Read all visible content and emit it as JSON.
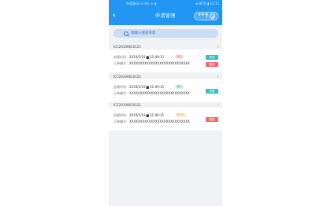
{
  "status_bar": {
    "left": "中国移动 ⊙ 4G ᯤ ▮",
    "right": "⊕ 85% ▮ 13:11"
  },
  "nav": {
    "back_icon": "‹",
    "title": "申请管理",
    "more_icon": "•••"
  },
  "search": {
    "placeholder": "请输入搜索内容"
  },
  "labels": {
    "time": "创建时间：",
    "order": "订单编号："
  },
  "cards": [
    {
      "order_no": "ICC20190610121",
      "time": "2019/5/19 ▆ 21:09:15",
      "order": "XXXXXXXXXXXXXXXXXXXXXXXXXXXX",
      "status": "驳回",
      "status_color": "#f56c6c",
      "buttons": [
        {
          "label": "修改",
          "color": "#31c2c2"
        },
        {
          "label": "删除",
          "color": "#f36a6a"
        }
      ]
    },
    {
      "order_no": "ICC20190610121",
      "time": "2019/5/19 ▆ 21:09:15",
      "order": "XXXXXXXXXXXXXXXXXXXXXXXXXXXX",
      "status": "通过",
      "status_color": "#43b86b",
      "buttons": [
        {
          "label": "查看",
          "color": "#31c2c2"
        }
      ]
    },
    {
      "order_no": "ICC20190610121",
      "time": "2019/5/19 ▆ 21:09:15",
      "order": "XXXXXXXXXXXXXXXXXXXXXXXXXXXX",
      "status": "审核中",
      "status_color": "#f5a623",
      "buttons": [
        {
          "label": "删除",
          "color": "#f36a6a"
        }
      ]
    }
  ]
}
